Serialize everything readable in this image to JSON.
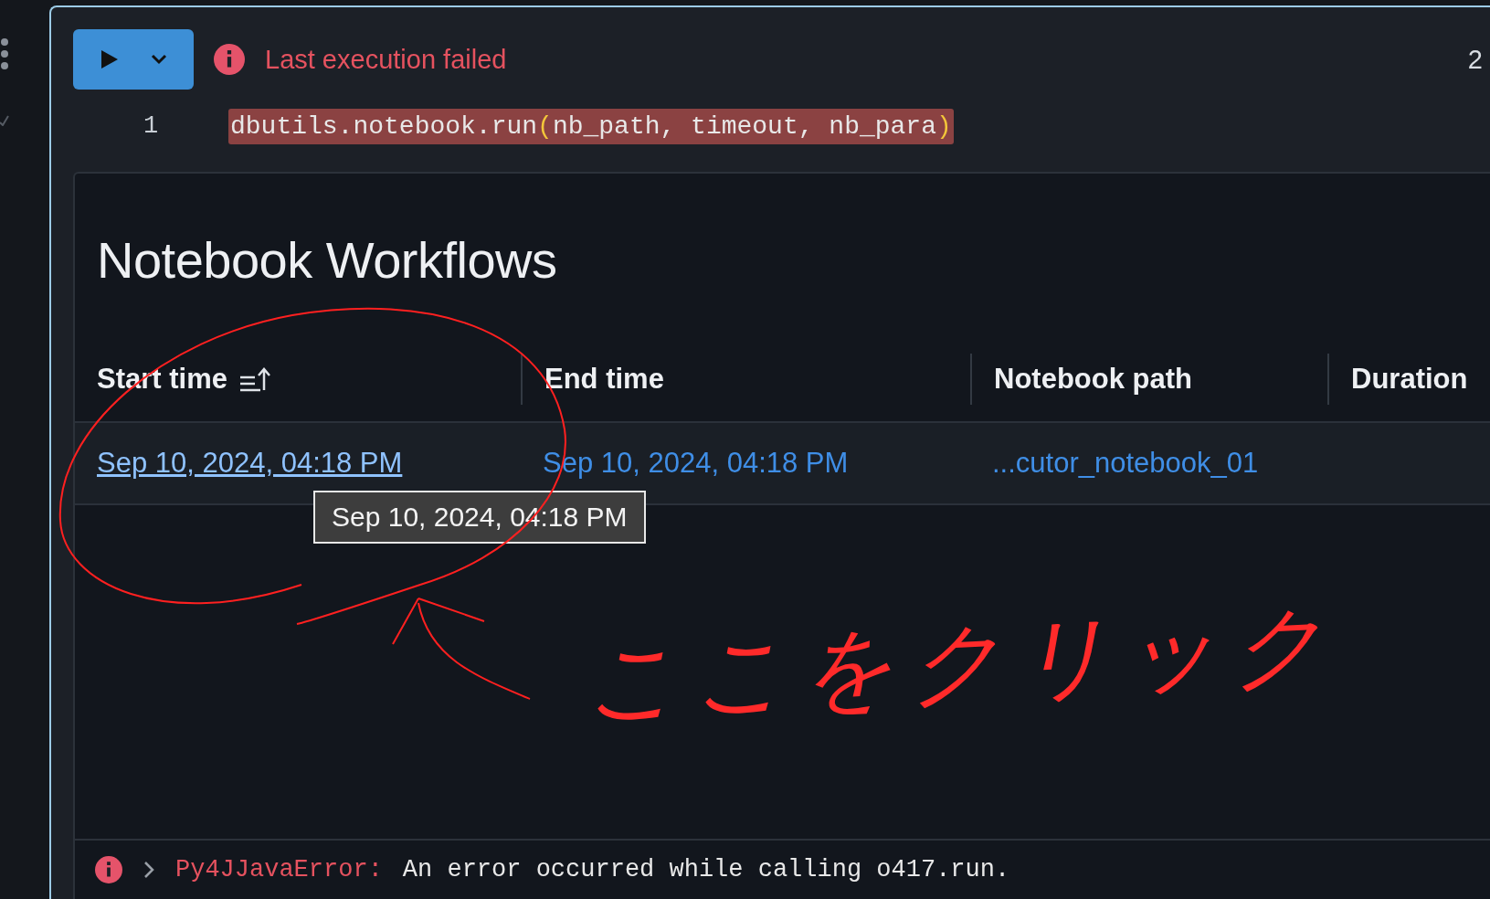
{
  "cell": {
    "status": {
      "kind": "error",
      "text": "Last execution failed"
    },
    "cell_number": "2",
    "code_lines": [
      {
        "number": "1",
        "tokens": [
          {
            "kind": "plain",
            "text": "dbutils.notebook.run"
          },
          {
            "kind": "paren",
            "text": "("
          },
          {
            "kind": "plain",
            "text": "nb_path, timeout, nb_para"
          },
          {
            "kind": "paren",
            "text": ")"
          }
        ],
        "error_highlight": true
      }
    ]
  },
  "results": {
    "title": "Notebook Workflows",
    "columns": [
      {
        "label": "Start time",
        "sorted": true
      },
      {
        "label": "End time",
        "sorted": false
      },
      {
        "label": "Notebook path",
        "sorted": false
      },
      {
        "label": "Duration",
        "sorted": false
      }
    ],
    "rows": [
      {
        "cells": [
          {
            "text": "Sep 10, 2024, 04:18 PM",
            "hovered": true
          },
          {
            "text": "Sep 10, 2024, 04:18 PM",
            "hovered": false
          },
          {
            "text": "...cutor_notebook_01",
            "hovered": false
          }
        ]
      }
    ],
    "tooltip": "Sep 10, 2024, 04:18 PM"
  },
  "annotation": {
    "text": "ここをクリック"
  },
  "error": {
    "type": "Py4JJavaError:",
    "message": "An error occurred while calling o417.run."
  }
}
